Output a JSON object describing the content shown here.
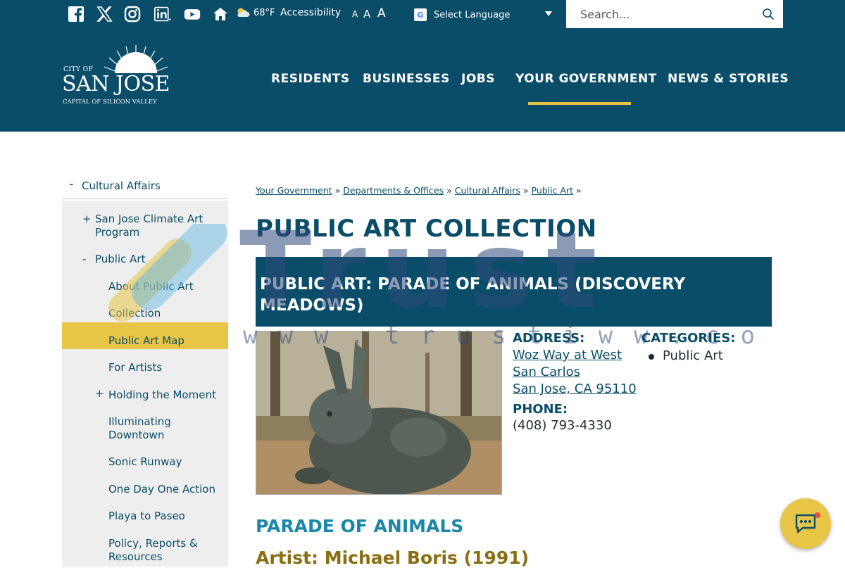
{
  "topbar": {
    "social_icons": [
      "facebook-icon",
      "x-icon",
      "instagram-icon",
      "linkedin-icon",
      "youtube-icon",
      "nextdoor-icon"
    ],
    "weather_temp": "68°F",
    "accessibility_label": "Accessibility",
    "font_sizes": [
      "A",
      "A",
      "A"
    ],
    "language_label": "Select Language",
    "search_placeholder": "Search..."
  },
  "header": {
    "logo_line1": "CITY OF",
    "logo_line2": "SAN JOSE",
    "logo_line3": "CAPITAL OF SILICON VALLEY",
    "nav": [
      "RESIDENTS",
      "BUSINESSES",
      "JOBS",
      "YOUR GOVERNMENT",
      "NEWS & STORIES"
    ]
  },
  "sidebar": {
    "top_label": "Cultural Affairs",
    "items": [
      {
        "label": "San Jose Climate Art Program",
        "sign": "+"
      },
      {
        "label": "Public Art",
        "sign": "-"
      },
      {
        "label": "About Public Art",
        "sign": ""
      },
      {
        "label": "Collection",
        "sign": ""
      },
      {
        "label": "Public Art Map",
        "sign": ""
      },
      {
        "label": "For Artists",
        "sign": ""
      },
      {
        "label": "Holding the Moment",
        "sign": "+"
      },
      {
        "label": "Illuminating Downtown",
        "sign": ""
      },
      {
        "label": "Sonic Runway",
        "sign": ""
      },
      {
        "label": "One Day One Action",
        "sign": ""
      },
      {
        "label": "Playa to Paseo",
        "sign": ""
      },
      {
        "label": "Policy, Reports & Resources",
        "sign": ""
      }
    ]
  },
  "breadcrumb": [
    "Your Government",
    "Departments & Offices",
    "Cultural Affairs",
    "Public Art"
  ],
  "breadcrumb_sep": "»",
  "page_title": "PUBLIC ART COLLECTION",
  "item": {
    "title": "PUBLIC ART: PARADE OF ANIMALS (DISCOVERY MEADOWS)",
    "address_label": "ADDRESS:",
    "address_line1": "Woz Way at West",
    "address_line2": "San Carlos",
    "address_line3": "San Jose, CA 95110",
    "phone_label": "PHONE:",
    "phone": "(408) 793-4330",
    "categories_label": "CATEGORIES:",
    "categories": [
      "Public Art"
    ],
    "subheading": "PARADE OF ANIMALS",
    "artist": "Artist: Michael Boris (1991)"
  },
  "watermark": {
    "word": "Trust",
    "url": "www.trustiww.com"
  },
  "colors": {
    "brand_teal": "#0a4d68",
    "accent_gold": "#e8c547",
    "link_blue": "#1a86a8"
  }
}
